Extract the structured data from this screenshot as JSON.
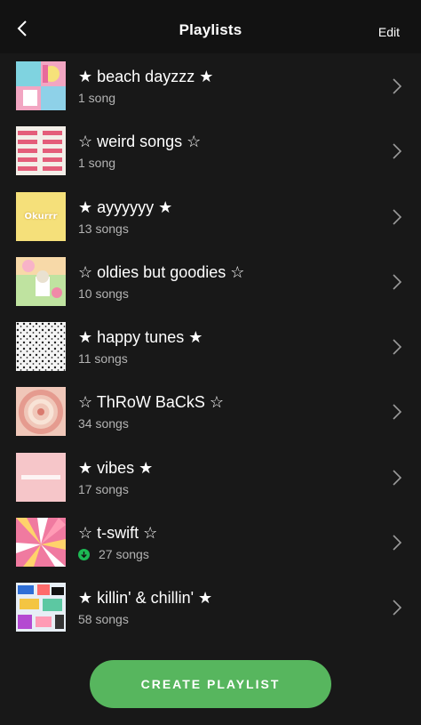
{
  "header": {
    "title": "Playlists",
    "edit_label": "Edit",
    "back_icon": "chevron-left-icon"
  },
  "colors": {
    "background": "#181818",
    "header": "#121212",
    "accent": "#1db954",
    "button": "#57b65e",
    "subtext": "#b3b3b3"
  },
  "playlists": [
    {
      "name": "★ beach dayzzz ★",
      "count": "1 song",
      "downloaded": false
    },
    {
      "name": "☆ weird songs ☆",
      "count": "1 song",
      "downloaded": false
    },
    {
      "name": "★ ayyyyyy ★",
      "count": "13 songs",
      "downloaded": false,
      "cover_text": "Okurrr"
    },
    {
      "name": "☆ oldies but goodies ☆",
      "count": "10 songs",
      "downloaded": false
    },
    {
      "name": "★ happy tunes ★",
      "count": "11 songs",
      "downloaded": false
    },
    {
      "name": "☆ ThRoW BaCkS ☆",
      "count": "34 songs",
      "downloaded": false
    },
    {
      "name": "★ vibes ★",
      "count": "17 songs",
      "downloaded": false
    },
    {
      "name": "☆ t-swift ☆",
      "count": "27 songs",
      "downloaded": true
    },
    {
      "name": "★  killin' & chillin' ★",
      "count": "58 songs",
      "downloaded": false
    }
  ],
  "create_button": {
    "label": "CREATE PLAYLIST"
  }
}
